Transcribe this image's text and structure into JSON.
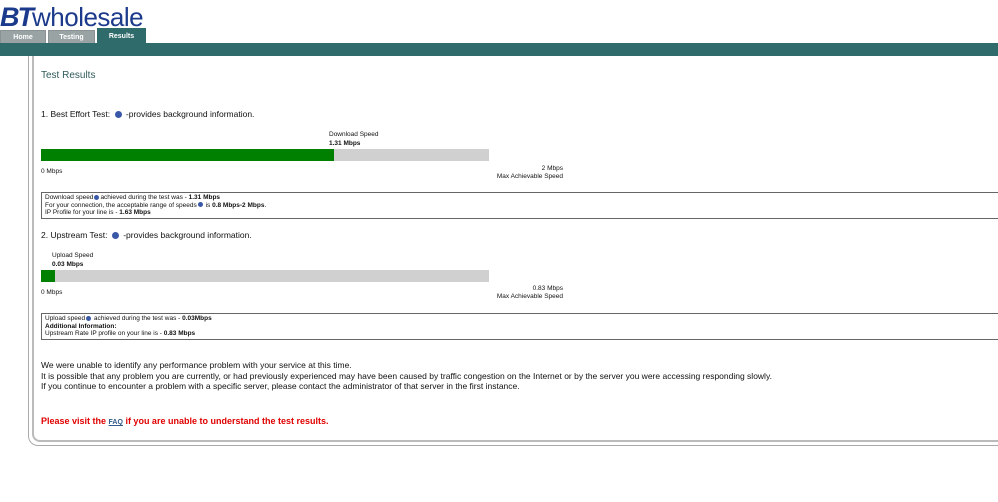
{
  "header": {
    "logo_bt": "BT",
    "logo_wholesale": "wholesale",
    "tabs": [
      {
        "label": "Home"
      },
      {
        "label": "Testing"
      },
      {
        "label": "Results"
      }
    ]
  },
  "page": {
    "title": "Test Results"
  },
  "best_effort": {
    "heading": "1. Best Effort Test:",
    "heading_suffix": "-provides background information.",
    "speed_label": "Download  Speed",
    "speed_value": "1.31 Mbps",
    "fill_fraction": 0.655,
    "axis_min": "0 Mbps",
    "axis_max": "2 Mbps",
    "axis_max_caption": "Max Achievable Speed",
    "box": {
      "line1_pre": "Download speed",
      "line1_mid": "achieved during the test was - ",
      "line1_val": "1.31 Mbps",
      "line2_pre": "For your connection, the acceptable range of speeds",
      "line2_mid": " is ",
      "line2_val": "0.8 Mbps-2 Mbps",
      "line2_end": ".",
      "line3_pre": "IP Profile for your line is - ",
      "line3_val": "1.63 Mbps"
    }
  },
  "upstream": {
    "heading": "2. Upstream Test:",
    "heading_suffix": "-provides background information.",
    "speed_label": "Upload Speed",
    "speed_value": "0.03 Mbps",
    "fill_fraction": 0.032,
    "axis_min": "0 Mbps",
    "axis_max": "0.83 Mbps",
    "axis_max_caption": "Max Achievable Speed",
    "box": {
      "line1_pre": "Upload speed",
      "line1_mid": " achieved during the test was - ",
      "line1_val": "0.03Mbps",
      "line2": "Additional Information:",
      "line3_pre": "Upstream Rate IP profile on your line is - ",
      "line3_val": "0.83 Mbps"
    }
  },
  "summary": {
    "line1": "We were unable to identify any performance problem with your service at this time.",
    "line2": "It is possible that any problem you are currently, or had previously experienced may have been caused by traffic congestion on the Internet or by the server you were accessing responding slowly.",
    "line3": "If you continue to encounter a problem with a specific server, please contact the administrator of that server in the first instance."
  },
  "faq": {
    "pre": "Please visit the ",
    "link": "FAQ",
    "post": " if you are unable to understand the test results."
  },
  "colors": {
    "teal": "#2f6b6a",
    "bar_fill": "#008000",
    "bar_track": "#d0d0d0",
    "faq_red": "#e00000",
    "logo_blue": "#1b3a8c"
  }
}
